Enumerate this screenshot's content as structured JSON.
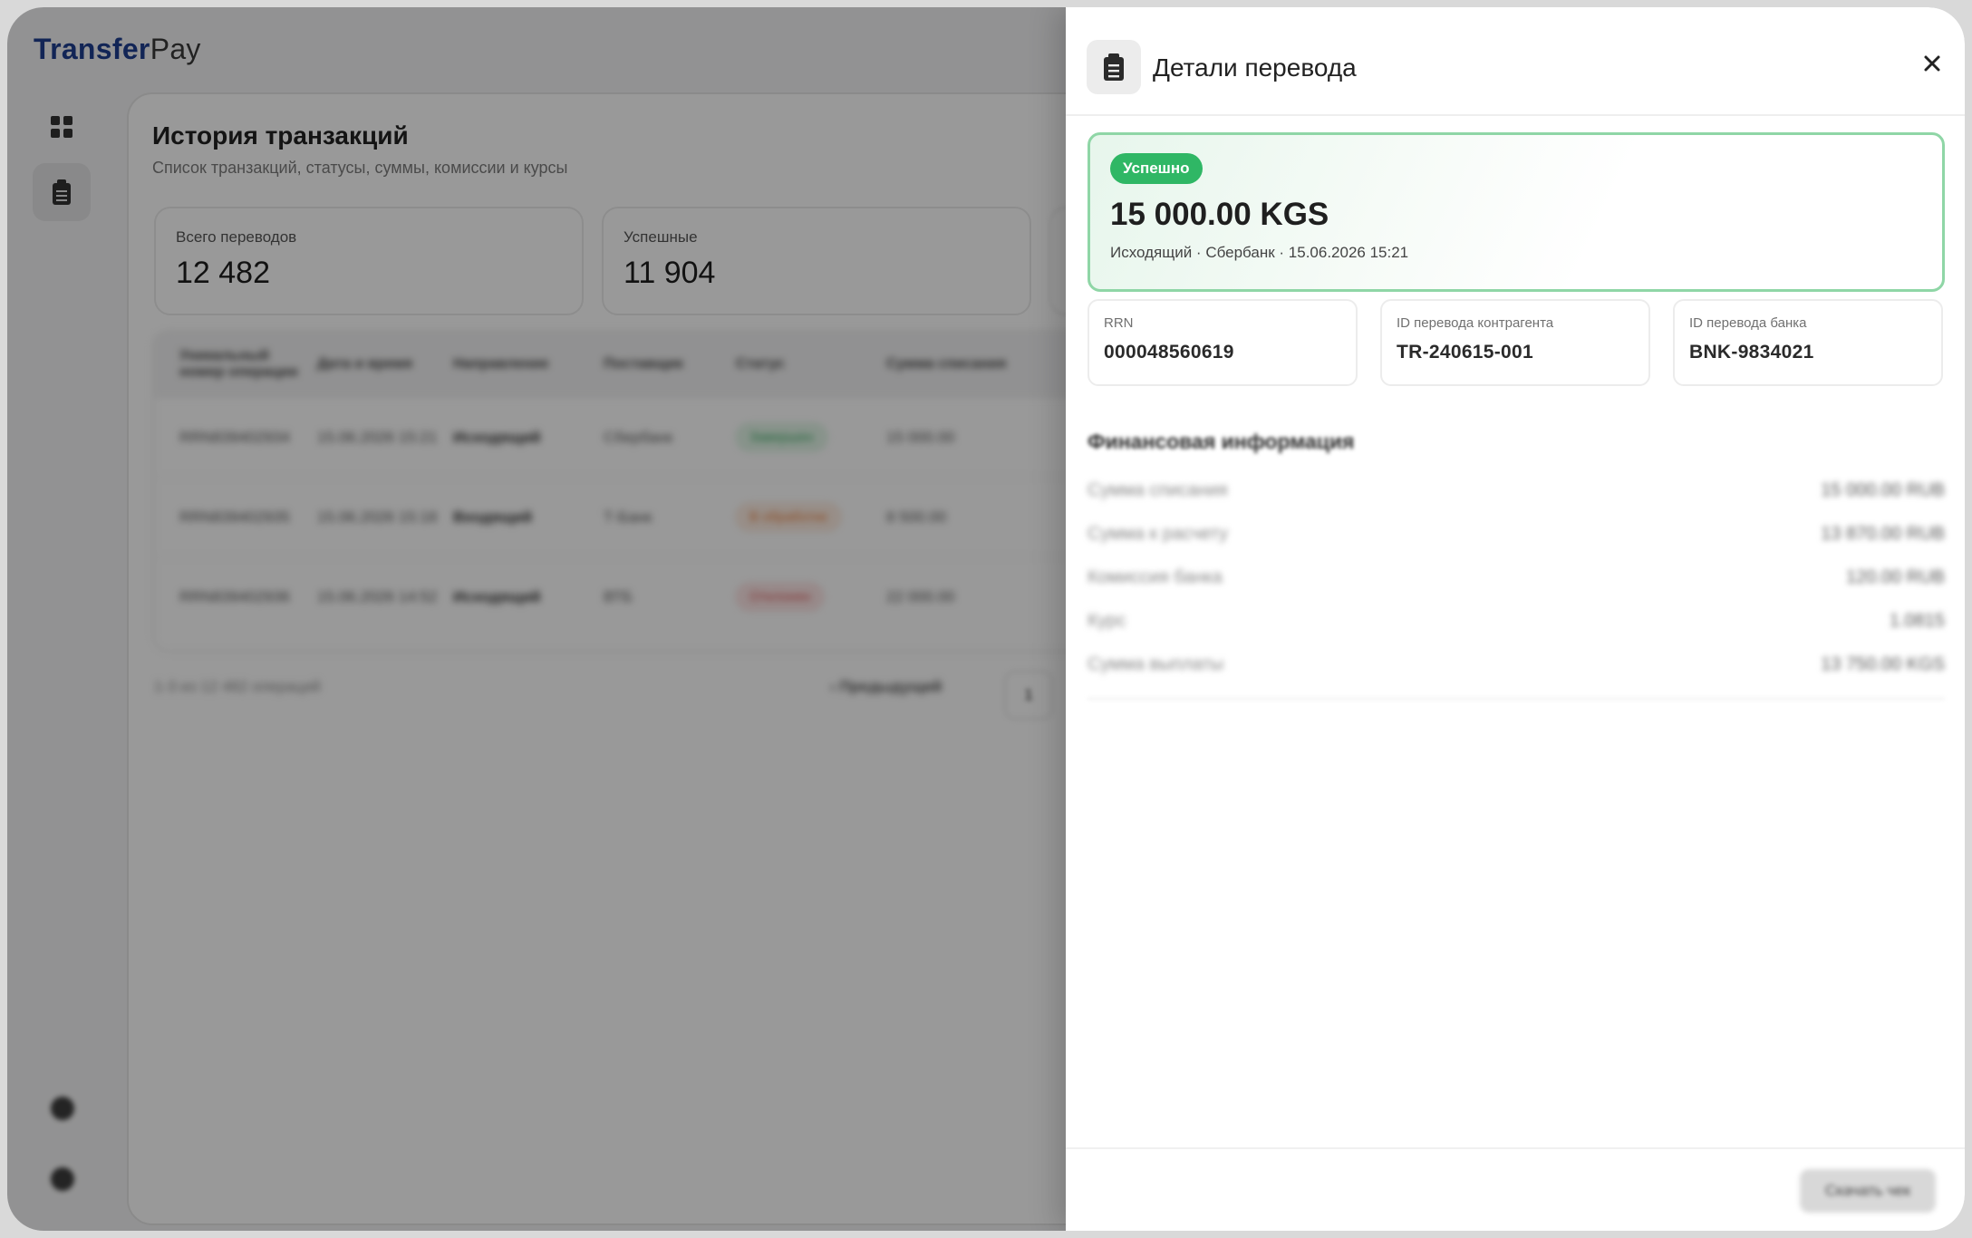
{
  "app": {
    "logo_part1": "Transfer",
    "logo_part2": "Pay"
  },
  "sidebar": {
    "items": [
      {
        "icon": "grid-icon"
      },
      {
        "icon": "clipboard-icon",
        "active": true
      }
    ],
    "bottom": [
      {
        "icon": "settings-icon"
      },
      {
        "icon": "logout-icon"
      }
    ]
  },
  "page": {
    "title": "История транзакций",
    "subtitle": "Список транзакций, статусы, суммы, комиссии и курсы"
  },
  "stats": [
    {
      "label": "Всего переводов",
      "value": "12 482"
    },
    {
      "label": "Успешные",
      "value": "11 904"
    }
  ],
  "table": {
    "columns": [
      "Уникальный номер операции",
      "Дата и время",
      "Направление",
      "Поставщик",
      "Статус",
      "Сумма списания"
    ],
    "rows": [
      {
        "id": "RRN839402934",
        "date": "15.06.2026 15:21",
        "direction": "Исходящий",
        "provider": "Сбербанк",
        "status": "Завершен",
        "status_kind": "g",
        "amount": "15 000.00"
      },
      {
        "id": "RRN839402935",
        "date": "15.06.2026 15:18",
        "direction": "Входящий",
        "provider": "Т-Банк",
        "status": "В обработке",
        "status_kind": "o",
        "amount": "8 500.00"
      },
      {
        "id": "RRN839402936",
        "date": "15.06.2026 14:52",
        "direction": "Исходящий",
        "provider": "ВТБ",
        "status": "Отклонен",
        "status_kind": "r",
        "amount": "22 000.00"
      }
    ],
    "footer_count": "1-3 из 12 482 операций",
    "prev_label": "‹ Предыдущий",
    "page_number": "1"
  },
  "drawer": {
    "icon": "clipboard-icon",
    "title": "Детали перевода",
    "close_icon": "close-icon",
    "status_badge": "Успешно",
    "amount": "15 000.00 KGS",
    "meta": "Исходящий · Сбербанк · 15.06.2026 15:21",
    "ids": [
      {
        "label": "RRN",
        "value": "000048560619"
      },
      {
        "label": "ID перевода контрагента",
        "value": "TR-240615-001"
      },
      {
        "label": "ID перевода банка",
        "value": "BNK-9834021"
      }
    ],
    "finance_title": "Финансовая информация",
    "finance_rows": [
      {
        "label": "Сумма списания",
        "value": "15 000.00 RUB"
      },
      {
        "label": "Сумма к расчету",
        "value": "13 870.00 RUB"
      },
      {
        "label": "Комиссия банка",
        "value": "120.00 RUB"
      },
      {
        "label": "Курс",
        "value": "1.0815"
      },
      {
        "label": "Сумма выплаты",
        "value": "13 750.00 KGS"
      }
    ],
    "download_button": "Скачать чек"
  },
  "colors": {
    "brand": "#1f3f8f",
    "success": "#2fb765",
    "hero_border": "#8fd6a6"
  }
}
